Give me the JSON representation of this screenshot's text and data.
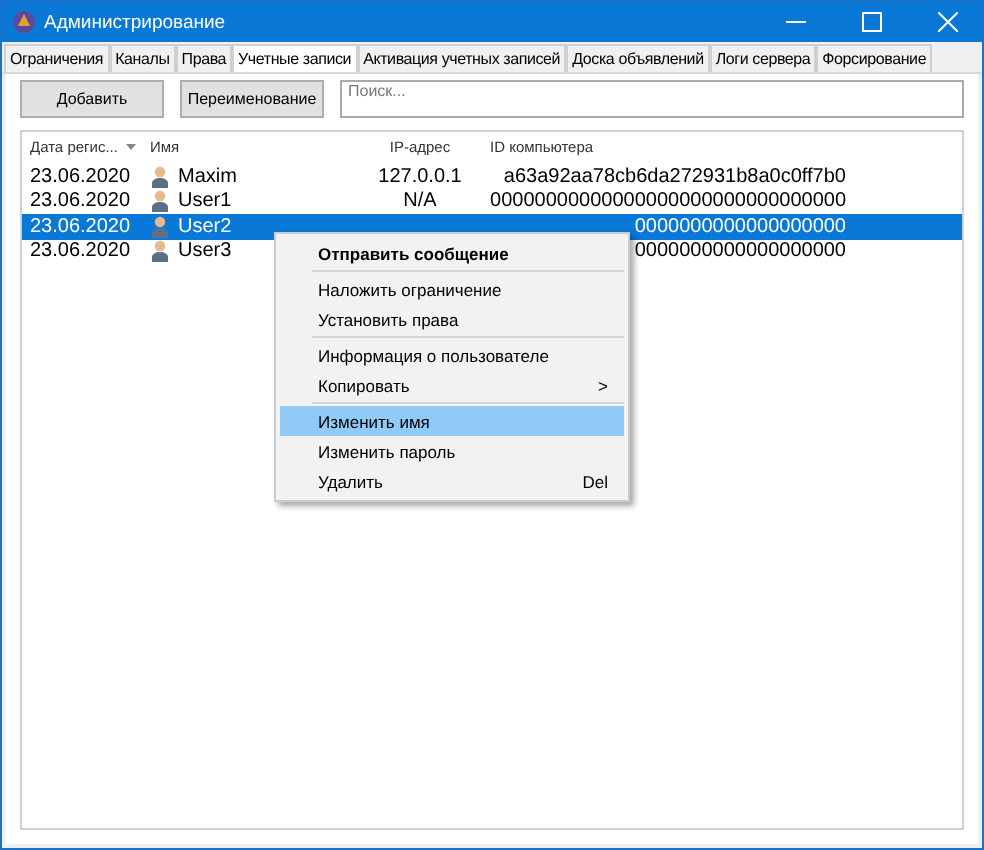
{
  "window": {
    "title": "Администрирование"
  },
  "tabs": [
    {
      "label": "Ограничения",
      "selected": false
    },
    {
      "label": "Каналы",
      "selected": false
    },
    {
      "label": "Права",
      "selected": false
    },
    {
      "label": "Учетные записи",
      "selected": true
    },
    {
      "label": "Активация учетных записей",
      "selected": false
    },
    {
      "label": "Доска объявлений",
      "selected": false
    },
    {
      "label": "Логи сервера",
      "selected": false
    },
    {
      "label": "Форсирование",
      "selected": false
    }
  ],
  "toolbar": {
    "buttons": [
      "Добавить",
      "Переименование"
    ],
    "search": {
      "placeholder": "Поиск..."
    }
  },
  "table": {
    "columns": [
      "Дата регис...",
      "Имя",
      "IP-адрес",
      "ID компьютера"
    ],
    "rows": [
      {
        "date": "23.06.2020",
        "name": "Maxim",
        "ip": "127.0.0.1",
        "id": "a63a92aa78cb6da272931b8a0c0ff7b0",
        "selected": false
      },
      {
        "date": "23.06.2020",
        "name": "User1",
        "ip": "N/A",
        "id": "00000000000000000000000000000000",
        "selected": false
      },
      {
        "date": "23.06.2020",
        "name": "User2",
        "id": "0000000000000000000",
        "selected": true
      },
      {
        "date": "23.06.2020",
        "name": "User3",
        "id": "0000000000000000000",
        "selected": false
      }
    ]
  },
  "context_menu": [
    {
      "kind": "item",
      "label": "Отправить сообщение",
      "default": true,
      "selected": false
    },
    {
      "kind": "separator"
    },
    {
      "kind": "item",
      "label": "Наложить ограничение",
      "selected": false
    },
    {
      "kind": "item",
      "label": "Установить права",
      "selected": false
    },
    {
      "kind": "separator"
    },
    {
      "kind": "item",
      "label": "Информация о пользователе",
      "selected": false
    },
    {
      "kind": "item",
      "label": "Копировать",
      "submenu": ">",
      "selected": false
    },
    {
      "kind": "separator"
    },
    {
      "kind": "item",
      "label": "Изменить имя",
      "selected": true
    },
    {
      "kind": "item",
      "label": "Изменить пароль",
      "selected": false
    },
    {
      "kind": "item",
      "label": "Удалить",
      "shortcut": "Del",
      "selected": false
    }
  ]
}
